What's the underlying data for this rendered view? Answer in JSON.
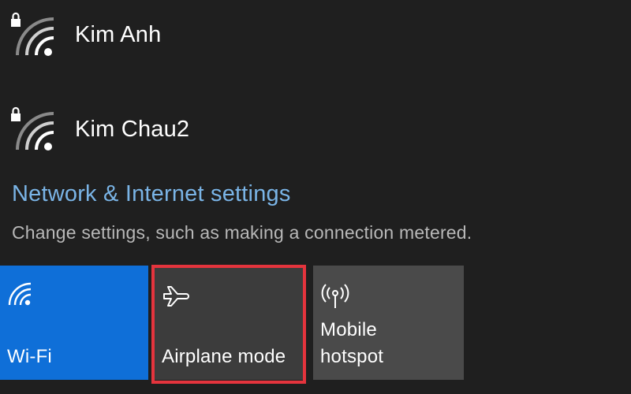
{
  "networks": [
    {
      "name": "Kim Anh",
      "icon": "wifi-secured-icon",
      "secured": true
    },
    {
      "name": "Kim Chau2",
      "icon": "wifi-secured-icon",
      "secured": true
    }
  ],
  "settings": {
    "link_label": "Network & Internet settings",
    "description": "Change settings, such as making a connection metered."
  },
  "tiles": [
    {
      "label": "Wi-Fi",
      "icon": "wifi-icon",
      "active": true,
      "color": "#0f6fd8"
    },
    {
      "label": "Airplane mode",
      "icon": "airplane-icon",
      "active": false,
      "color": "#3c3c3c",
      "highlighted": true
    },
    {
      "label_line1": "Mobile",
      "label_line2": "hotspot",
      "icon": "mobile-hotspot-icon",
      "active": false,
      "color": "#4a4a4a"
    }
  ],
  "colors": {
    "background": "#1f1f1f",
    "link": "#7ab4e6",
    "highlight": "#e4343d"
  }
}
